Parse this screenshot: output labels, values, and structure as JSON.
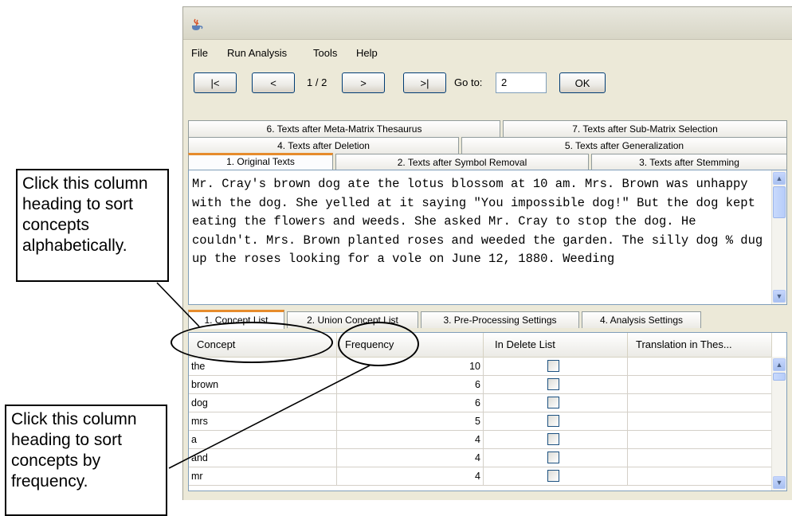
{
  "menu": [
    "File",
    "Run Analysis",
    "Tools",
    "Help"
  ],
  "nav": {
    "first": "|<",
    "prev": "<",
    "page": "1 / 2",
    "next": ">",
    "last": ">|",
    "goto_label": "Go to:",
    "goto_value": "2",
    "ok": "OK"
  },
  "text_tabs": {
    "row1": [
      "6. Texts after Meta-Matrix Thesaurus",
      "7. Texts after Sub-Matrix Selection"
    ],
    "row2": [
      "4. Texts after Deletion",
      "5. Texts after Generalization"
    ],
    "row3": [
      "1. Original Texts",
      "2. Texts after Symbol Removal",
      "3. Texts after Stemming"
    ],
    "selected": "1. Original Texts"
  },
  "original_text": "Mr. Cray's brown dog ate the lotus blossom at 10 am. Mrs. Brown was unhappy with the dog. She yelled at it saying \"You impossible dog!\" But the dog kept eating the flowers and weeds. She asked Mr. Cray to stop the dog. He couldn't. Mrs. Brown planted roses and weeded the garden. The silly dog % dug up the roses looking for a vole on June 12, 1880. Weeding",
  "bottom_tabs": [
    "1. Concept List",
    "2. Union Concept List",
    "3. Pre-Processing Settings",
    "4. Analysis Settings"
  ],
  "table": {
    "columns": [
      "Concept",
      "Frequency",
      "In Delete List",
      "Translation in Thes..."
    ],
    "rows": [
      {
        "concept": "the",
        "frequency": "10",
        "in_delete_list": false
      },
      {
        "concept": "brown",
        "frequency": "6",
        "in_delete_list": false
      },
      {
        "concept": "dog",
        "frequency": "6",
        "in_delete_list": false
      },
      {
        "concept": "mrs",
        "frequency": "5",
        "in_delete_list": false
      },
      {
        "concept": "a",
        "frequency": "4",
        "in_delete_list": false
      },
      {
        "concept": "and",
        "frequency": "4",
        "in_delete_list": false
      },
      {
        "concept": "mr",
        "frequency": "4",
        "in_delete_list": false
      }
    ]
  },
  "callouts": {
    "concept": "Click this column heading to sort concepts alphabetically.",
    "frequency": "Click this column heading to sort concepts by frequency."
  },
  "icons": [
    "java-cup-icon",
    "scroll-up-icon",
    "scroll-down-icon"
  ],
  "colors": {
    "selected_tab_accent": "#e68b2c",
    "window_bg": "#ece9d8",
    "scroll_blue": "#b7cdf9"
  }
}
